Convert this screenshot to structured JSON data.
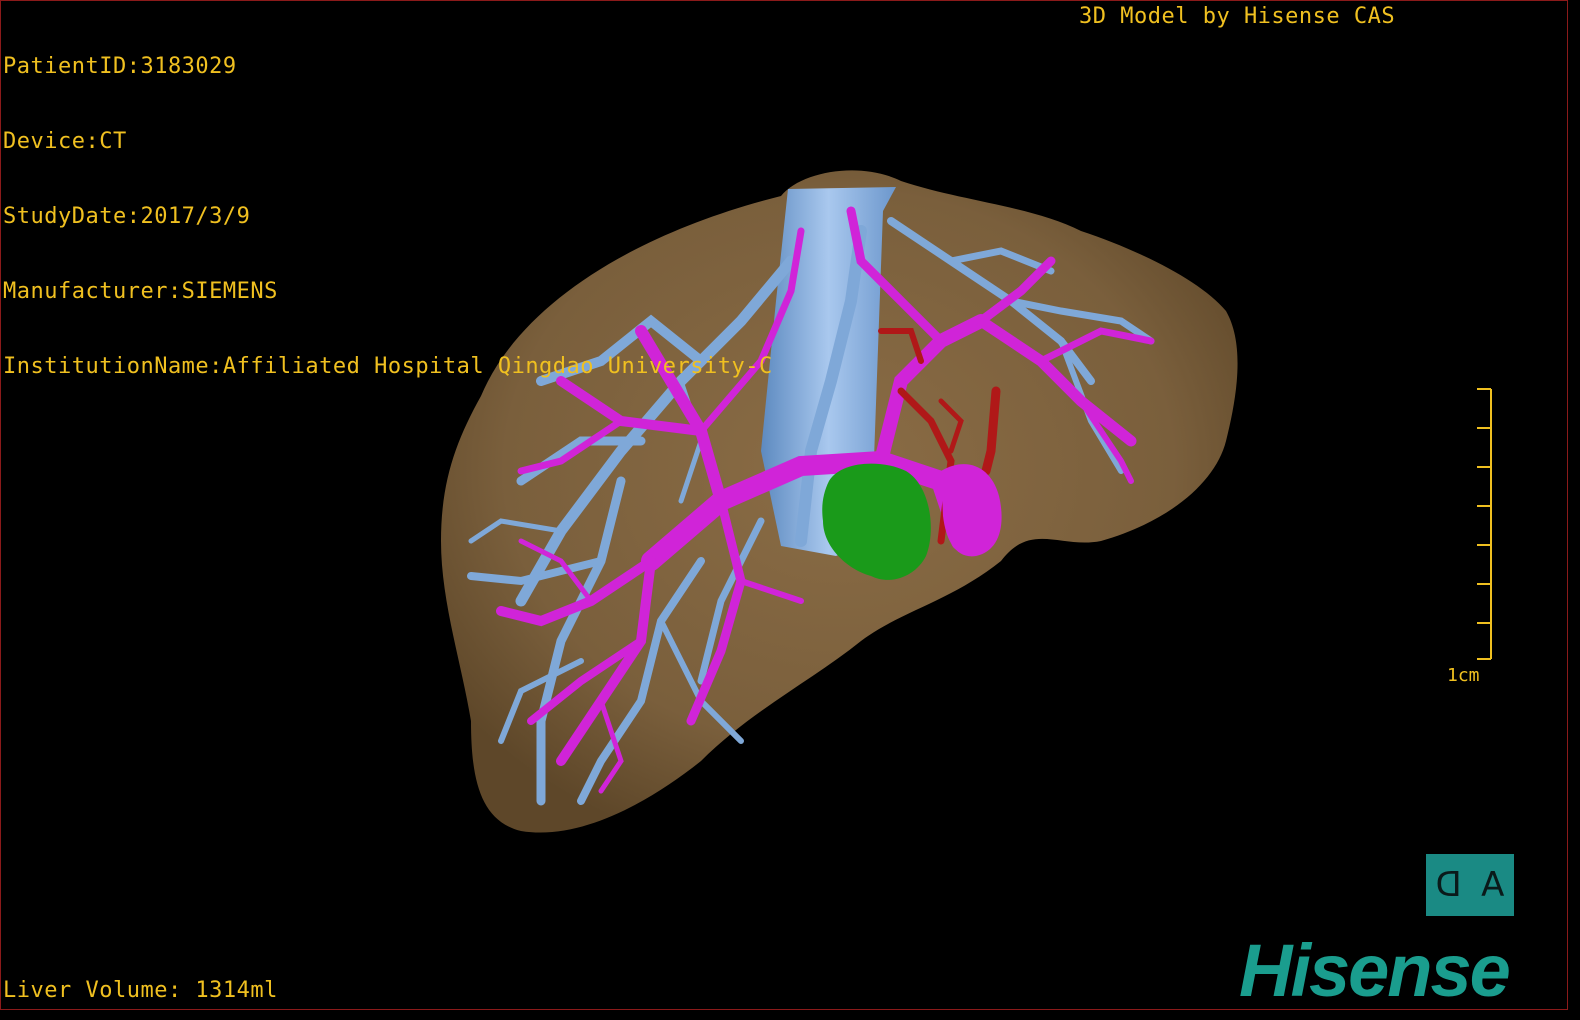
{
  "patient_info": {
    "lines": [
      "PatientID:3183029",
      "Device:CT",
      "StudyDate:2017/3/9",
      "Manufacturer:SIEMENS",
      "InstitutionName:Affiliated Hospital Qingdao University-C"
    ]
  },
  "model_credit": "3D Model by Hisense CAS",
  "liver_volume": "Liver Volume: 1314ml",
  "scale": {
    "label": "1cm",
    "ticks": 8
  },
  "orientation_cube": {
    "left_glyph": "ᗡ",
    "right_glyph": "A"
  },
  "logo": "Hisense",
  "colors": {
    "liver": "#7a5f3c",
    "portal_vein": "#d024d8",
    "hepatic_vein": "#7fa8d8",
    "artery": "#b01818",
    "tumor": "#1a9a1a",
    "overlay_text": "#f0c020",
    "brand": "#1a9d8e"
  }
}
